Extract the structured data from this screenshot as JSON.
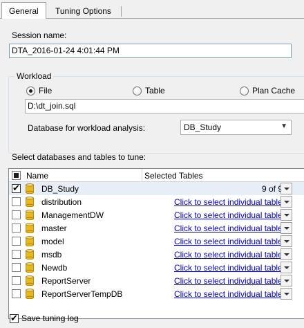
{
  "tabs": [
    {
      "label": "General",
      "active": true
    },
    {
      "label": "Tuning Options",
      "active": false
    }
  ],
  "session": {
    "label": "Session name:",
    "value": "DTA_2016-01-24 4:01:44 PM"
  },
  "workload": {
    "title": "Workload",
    "options": [
      {
        "label": "File",
        "selected": true
      },
      {
        "label": "Table",
        "selected": false
      },
      {
        "label": "Plan Cache",
        "selected": false
      }
    ],
    "file_path": "D:\\dt_join.sql",
    "database_label": "Database for workload analysis:",
    "database_value": "DB_Study"
  },
  "databases": {
    "section_label": "Select databases and tables to tune:",
    "columns": {
      "name": "Name",
      "tables": "Selected Tables"
    },
    "header_checkbox": "indeterminate",
    "rows": [
      {
        "name": "DB_Study",
        "checked": true,
        "tables_text": "9 of 9",
        "is_link": false
      },
      {
        "name": "distribution",
        "checked": false,
        "tables_text": "Click to select individual tables",
        "is_link": true
      },
      {
        "name": "ManagementDW",
        "checked": false,
        "tables_text": "Click to select individual tables",
        "is_link": true
      },
      {
        "name": "master",
        "checked": false,
        "tables_text": "Click to select individual tables",
        "is_link": true
      },
      {
        "name": "model",
        "checked": false,
        "tables_text": "Click to select individual tables",
        "is_link": true
      },
      {
        "name": "msdb",
        "checked": false,
        "tables_text": "Click to select individual tables",
        "is_link": true
      },
      {
        "name": "Newdb",
        "checked": false,
        "tables_text": "Click to select individual tables",
        "is_link": true
      },
      {
        "name": "ReportServer",
        "checked": false,
        "tables_text": "Click to select individual tables",
        "is_link": true
      },
      {
        "name": "ReportServerTempDB",
        "checked": false,
        "tables_text": "Click to select individual tables",
        "is_link": true
      }
    ]
  },
  "save_log": {
    "label": "Save tuning log",
    "checked": true
  },
  "colors": {
    "link": "#0000cc",
    "db_icon": "#e8b820",
    "selected_row": "#e8eef6"
  },
  "icons": {
    "database": "database-cylinder-icon",
    "dropdown": "chevron-down-icon"
  }
}
